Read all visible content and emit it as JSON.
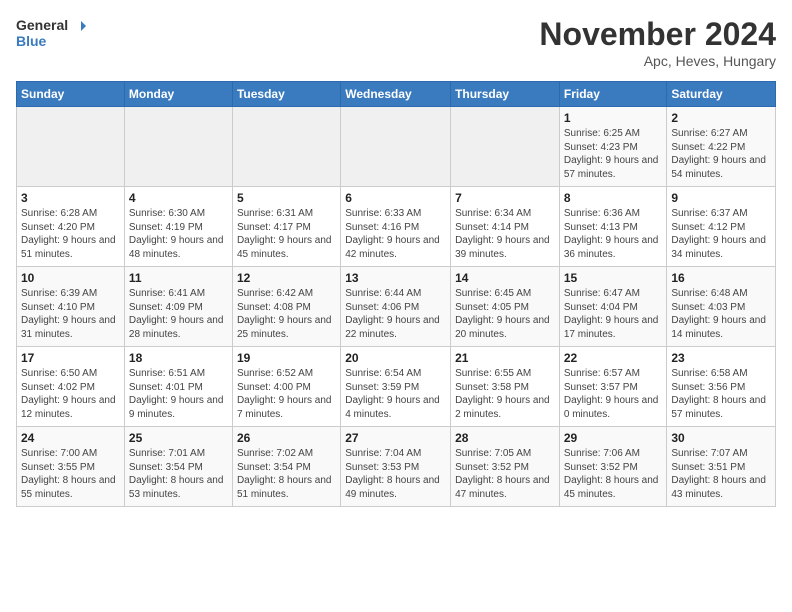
{
  "header": {
    "logo_line1": "General",
    "logo_line2": "Blue",
    "month_title": "November 2024",
    "location": "Apc, Heves, Hungary"
  },
  "weekdays": [
    "Sunday",
    "Monday",
    "Tuesday",
    "Wednesday",
    "Thursday",
    "Friday",
    "Saturday"
  ],
  "weeks": [
    [
      {
        "day": "",
        "info": ""
      },
      {
        "day": "",
        "info": ""
      },
      {
        "day": "",
        "info": ""
      },
      {
        "day": "",
        "info": ""
      },
      {
        "day": "",
        "info": ""
      },
      {
        "day": "1",
        "info": "Sunrise: 6:25 AM\nSunset: 4:23 PM\nDaylight: 9 hours and 57 minutes."
      },
      {
        "day": "2",
        "info": "Sunrise: 6:27 AM\nSunset: 4:22 PM\nDaylight: 9 hours and 54 minutes."
      }
    ],
    [
      {
        "day": "3",
        "info": "Sunrise: 6:28 AM\nSunset: 4:20 PM\nDaylight: 9 hours and 51 minutes."
      },
      {
        "day": "4",
        "info": "Sunrise: 6:30 AM\nSunset: 4:19 PM\nDaylight: 9 hours and 48 minutes."
      },
      {
        "day": "5",
        "info": "Sunrise: 6:31 AM\nSunset: 4:17 PM\nDaylight: 9 hours and 45 minutes."
      },
      {
        "day": "6",
        "info": "Sunrise: 6:33 AM\nSunset: 4:16 PM\nDaylight: 9 hours and 42 minutes."
      },
      {
        "day": "7",
        "info": "Sunrise: 6:34 AM\nSunset: 4:14 PM\nDaylight: 9 hours and 39 minutes."
      },
      {
        "day": "8",
        "info": "Sunrise: 6:36 AM\nSunset: 4:13 PM\nDaylight: 9 hours and 36 minutes."
      },
      {
        "day": "9",
        "info": "Sunrise: 6:37 AM\nSunset: 4:12 PM\nDaylight: 9 hours and 34 minutes."
      }
    ],
    [
      {
        "day": "10",
        "info": "Sunrise: 6:39 AM\nSunset: 4:10 PM\nDaylight: 9 hours and 31 minutes."
      },
      {
        "day": "11",
        "info": "Sunrise: 6:41 AM\nSunset: 4:09 PM\nDaylight: 9 hours and 28 minutes."
      },
      {
        "day": "12",
        "info": "Sunrise: 6:42 AM\nSunset: 4:08 PM\nDaylight: 9 hours and 25 minutes."
      },
      {
        "day": "13",
        "info": "Sunrise: 6:44 AM\nSunset: 4:06 PM\nDaylight: 9 hours and 22 minutes."
      },
      {
        "day": "14",
        "info": "Sunrise: 6:45 AM\nSunset: 4:05 PM\nDaylight: 9 hours and 20 minutes."
      },
      {
        "day": "15",
        "info": "Sunrise: 6:47 AM\nSunset: 4:04 PM\nDaylight: 9 hours and 17 minutes."
      },
      {
        "day": "16",
        "info": "Sunrise: 6:48 AM\nSunset: 4:03 PM\nDaylight: 9 hours and 14 minutes."
      }
    ],
    [
      {
        "day": "17",
        "info": "Sunrise: 6:50 AM\nSunset: 4:02 PM\nDaylight: 9 hours and 12 minutes."
      },
      {
        "day": "18",
        "info": "Sunrise: 6:51 AM\nSunset: 4:01 PM\nDaylight: 9 hours and 9 minutes."
      },
      {
        "day": "19",
        "info": "Sunrise: 6:52 AM\nSunset: 4:00 PM\nDaylight: 9 hours and 7 minutes."
      },
      {
        "day": "20",
        "info": "Sunrise: 6:54 AM\nSunset: 3:59 PM\nDaylight: 9 hours and 4 minutes."
      },
      {
        "day": "21",
        "info": "Sunrise: 6:55 AM\nSunset: 3:58 PM\nDaylight: 9 hours and 2 minutes."
      },
      {
        "day": "22",
        "info": "Sunrise: 6:57 AM\nSunset: 3:57 PM\nDaylight: 9 hours and 0 minutes."
      },
      {
        "day": "23",
        "info": "Sunrise: 6:58 AM\nSunset: 3:56 PM\nDaylight: 8 hours and 57 minutes."
      }
    ],
    [
      {
        "day": "24",
        "info": "Sunrise: 7:00 AM\nSunset: 3:55 PM\nDaylight: 8 hours and 55 minutes."
      },
      {
        "day": "25",
        "info": "Sunrise: 7:01 AM\nSunset: 3:54 PM\nDaylight: 8 hours and 53 minutes."
      },
      {
        "day": "26",
        "info": "Sunrise: 7:02 AM\nSunset: 3:54 PM\nDaylight: 8 hours and 51 minutes."
      },
      {
        "day": "27",
        "info": "Sunrise: 7:04 AM\nSunset: 3:53 PM\nDaylight: 8 hours and 49 minutes."
      },
      {
        "day": "28",
        "info": "Sunrise: 7:05 AM\nSunset: 3:52 PM\nDaylight: 8 hours and 47 minutes."
      },
      {
        "day": "29",
        "info": "Sunrise: 7:06 AM\nSunset: 3:52 PM\nDaylight: 8 hours and 45 minutes."
      },
      {
        "day": "30",
        "info": "Sunrise: 7:07 AM\nSunset: 3:51 PM\nDaylight: 8 hours and 43 minutes."
      }
    ]
  ]
}
